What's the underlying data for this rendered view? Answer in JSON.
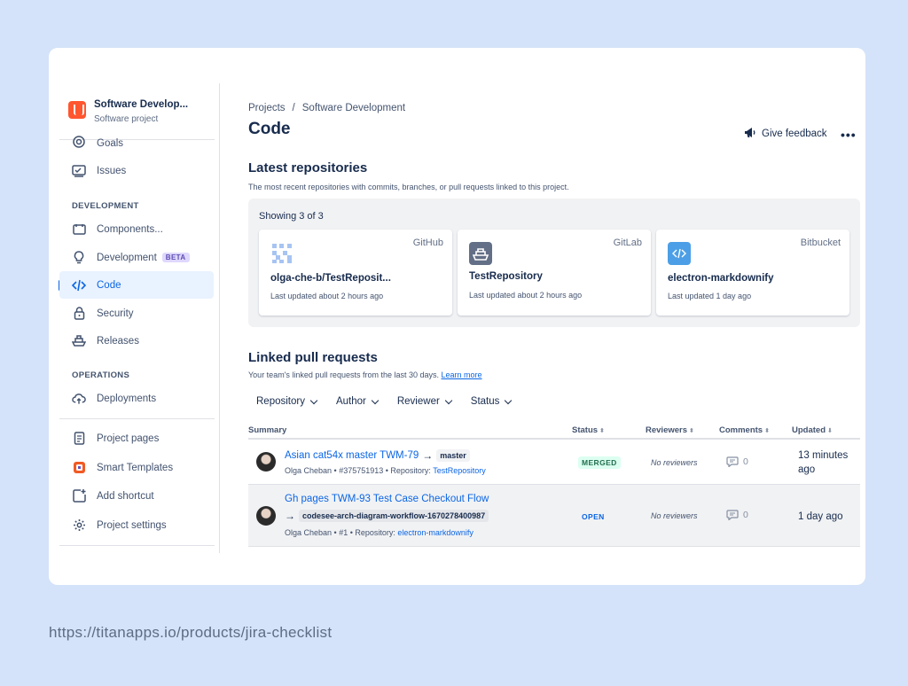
{
  "project": {
    "name": "Software Develop...",
    "type": "Software project"
  },
  "sidebar": {
    "top_items": [
      {
        "label": "Goals",
        "icon": "target-icon"
      },
      {
        "label": "Issues",
        "icon": "issues-icon"
      }
    ],
    "sections": [
      {
        "label": "DEVELOPMENT"
      },
      {
        "label": "OPERATIONS"
      }
    ],
    "dev_items": [
      {
        "label": "Components..."
      },
      {
        "label": "Development",
        "badge": "BETA"
      },
      {
        "label": "Code"
      },
      {
        "label": "Security"
      },
      {
        "label": "Releases"
      }
    ],
    "ops_items": [
      {
        "label": "Deployments"
      }
    ],
    "bottom_items": [
      {
        "label": "Project pages"
      },
      {
        "label": "Smart Templates"
      },
      {
        "label": "Add shortcut"
      },
      {
        "label": "Project settings"
      }
    ]
  },
  "breadcrumb": {
    "projects": "Projects",
    "separator": "/",
    "current": "Software Development"
  },
  "page_title": "Code",
  "feedback_label": "Give feedback",
  "more_label": "•••",
  "repos": {
    "heading": "Latest repositories",
    "description": "The most recent repositories with commits, branches, or pull requests linked to this project.",
    "showing": "Showing 3 of 3",
    "items": [
      {
        "provider": "GitHub",
        "name": "olga-che-b/TestReposit...",
        "updated": "Last updated about 2 hours ago"
      },
      {
        "provider": "GitLab",
        "name": "TestRepository",
        "updated": "Last updated about 2 hours ago"
      },
      {
        "provider": "Bitbucket",
        "name": "electron-markdownify",
        "updated": "Last updated 1 day ago"
      }
    ]
  },
  "pulls": {
    "heading": "Linked pull requests",
    "description": "Your team's linked pull requests from the last 30 days.",
    "learn_more": "Learn more",
    "filters": [
      "Repository",
      "Author",
      "Reviewer",
      "Status"
    ],
    "columns": [
      "Summary",
      "Status",
      "Reviewers",
      "Comments",
      "Updated"
    ],
    "rows": [
      {
        "title": "Asian cat54x master TWM-79",
        "arrow": "→",
        "branch": "master",
        "meta_author": "Olga Cheban • #375751913 • Repository: ",
        "meta_repo": "TestRepository",
        "status": "MERGED",
        "reviewers": "No reviewers",
        "comments": "0",
        "updated": "13 minutes ago"
      },
      {
        "title": "Gh pages TWM-93 Test Case Checkout Flow",
        "arrow": "→",
        "branch": "codesee-arch-diagram-workflow-1670278400987",
        "meta_author": "Olga Cheban • #1 • Repository: ",
        "meta_repo": "electron-markdownify",
        "status": "OPEN",
        "reviewers": "No reviewers",
        "comments": "0",
        "updated": "1 day ago"
      }
    ]
  },
  "footer_url": "https://titanapps.io/products/jira-checklist"
}
